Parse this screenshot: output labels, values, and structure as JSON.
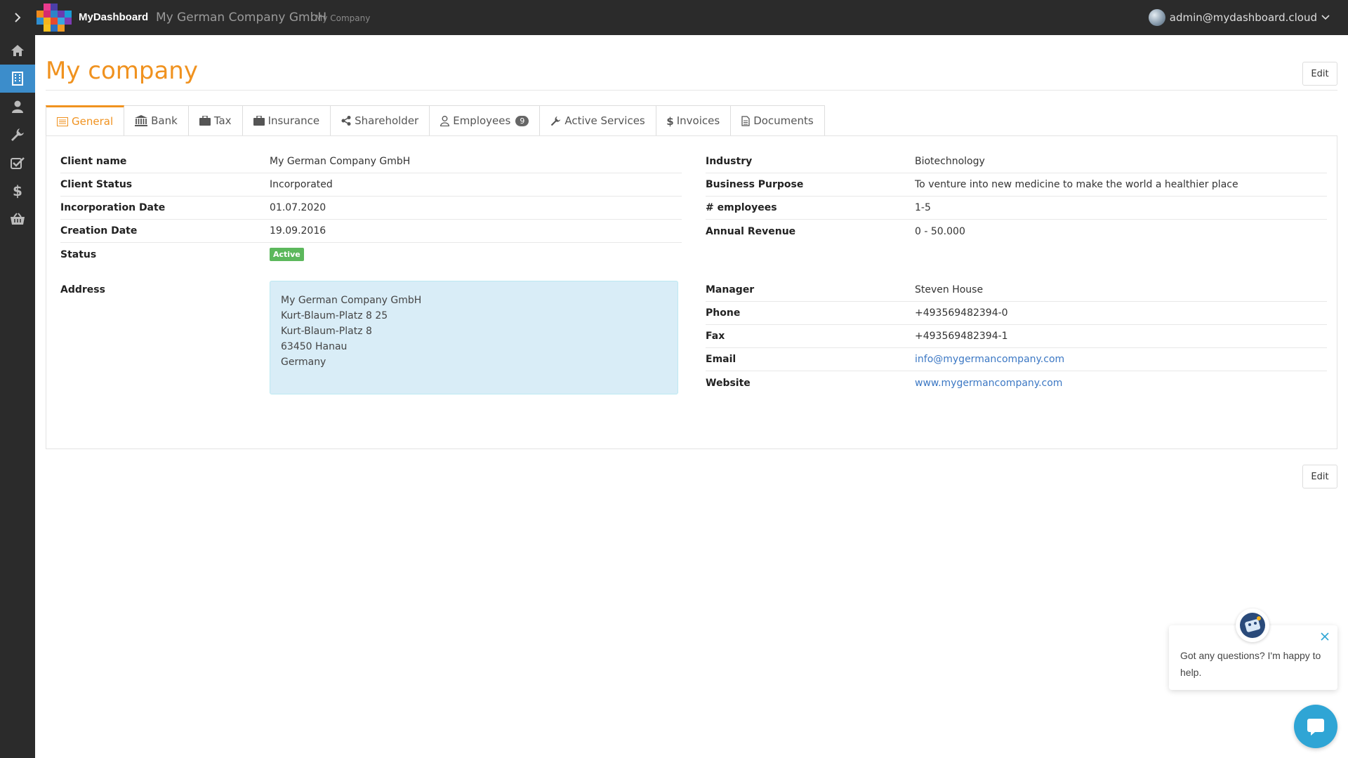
{
  "header": {
    "brand": "MyDashboard",
    "company": "My German Company GmbH",
    "company_sub": "My Company",
    "user": "admin@mydashboard.cloud"
  },
  "sidebar": {
    "items": [
      {
        "icon": "home-icon"
      },
      {
        "icon": "building-icon",
        "active": true
      },
      {
        "icon": "user-icon"
      },
      {
        "icon": "wrench-icon"
      },
      {
        "icon": "check-square-icon"
      },
      {
        "icon": "dollar-icon"
      },
      {
        "icon": "basket-icon"
      }
    ]
  },
  "page": {
    "title": "My company",
    "edit_label": "Edit"
  },
  "tabs": [
    {
      "label": "General",
      "icon": "list-icon"
    },
    {
      "label": "Bank",
      "icon": "bank-icon"
    },
    {
      "label": "Tax",
      "icon": "briefcase-icon"
    },
    {
      "label": "Insurance",
      "icon": "briefcase-icon"
    },
    {
      "label": "Shareholder",
      "icon": "share-icon"
    },
    {
      "label": "Employees",
      "icon": "user-icon",
      "count": "9"
    },
    {
      "label": "Active Services",
      "icon": "wrench-icon"
    },
    {
      "label": "Invoices",
      "icon": "dollar-icon"
    },
    {
      "label": "Documents",
      "icon": "file-icon"
    }
  ],
  "general": {
    "left": [
      {
        "label": "Client name",
        "value": "My German Company GmbH"
      },
      {
        "label": "Client Status",
        "value": "Incorporated"
      },
      {
        "label": "Incorporation Date",
        "value": "01.07.2020"
      },
      {
        "label": "Creation Date",
        "value": "19.09.2016"
      },
      {
        "label": "Status",
        "value": "Active"
      }
    ],
    "right": [
      {
        "label": "Industry",
        "value": "Biotechnology"
      },
      {
        "label": "Business Purpose",
        "value": "To venture into new medicine to make the world a healthier place"
      },
      {
        "label": "# employees",
        "value": "1-5"
      },
      {
        "label": "Annual Revenue",
        "value": "0 - 50.000"
      }
    ],
    "address_label": "Address",
    "address": [
      "My German Company GmbH",
      "Kurt-Blaum-Platz 8 25",
      "Kurt-Blaum-Platz 8",
      "63450 Hanau",
      "Germany"
    ],
    "contact": [
      {
        "label": "Manager",
        "value": "Steven House"
      },
      {
        "label": "Phone",
        "value": "+493569482394-0"
      },
      {
        "label": "Fax",
        "value": "+493569482394-1"
      },
      {
        "label": "Email",
        "value": "info@mygermancompany.com",
        "link": true
      },
      {
        "label": "Website",
        "value": "www.mygermancompany.com",
        "link": true
      }
    ]
  },
  "chat": {
    "message": "Got any questions? I'm happy to help."
  },
  "colors": {
    "accent": "#f0921f",
    "sidebar_active": "#3c8dcb",
    "status_active": "#5cb85c",
    "address_bg": "#d9edf7",
    "chat": "#2fa5d5"
  }
}
